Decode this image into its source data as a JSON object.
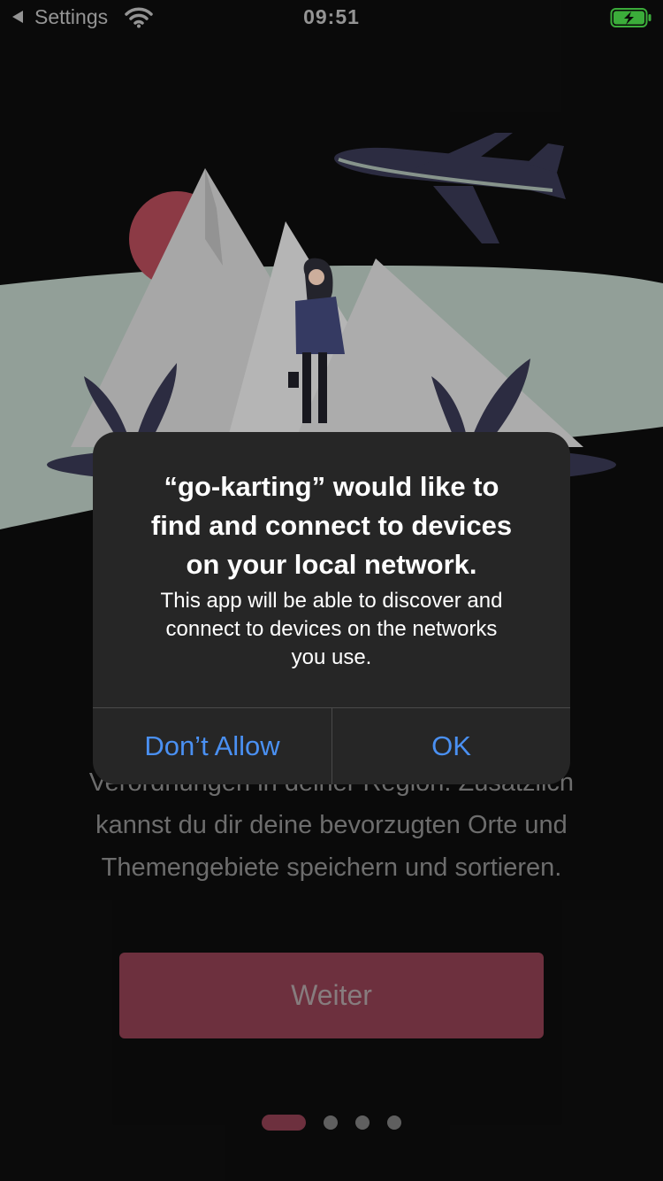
{
  "status_bar": {
    "back_label": "Settings",
    "time": "09:51",
    "icons": [
      "back-arrow-icon",
      "wifi-icon",
      "battery-charging-icon"
    ],
    "battery_color": "#44c443"
  },
  "onboarding": {
    "illustration": "traveler-mountains-airplane-illustration",
    "body_lines": [
      "Verordnungen in deiner Region. Zusätzlich",
      "kannst du dir deine bevorzugten Orte und",
      "Themengebiete speichern und sortieren."
    ],
    "button_label": "Weiter",
    "page_count": 4,
    "current_page": 1,
    "accent_color": "#7d3747"
  },
  "alert": {
    "title_lines": [
      "“go-karting” would like to",
      "find and connect to devices",
      "on your local network."
    ],
    "message_lines": [
      "This app will be able to discover and",
      "connect to devices on the networks",
      "you use."
    ],
    "deny_label": "Don’t Allow",
    "ok_label": "OK",
    "button_color": "#4a90f2"
  }
}
